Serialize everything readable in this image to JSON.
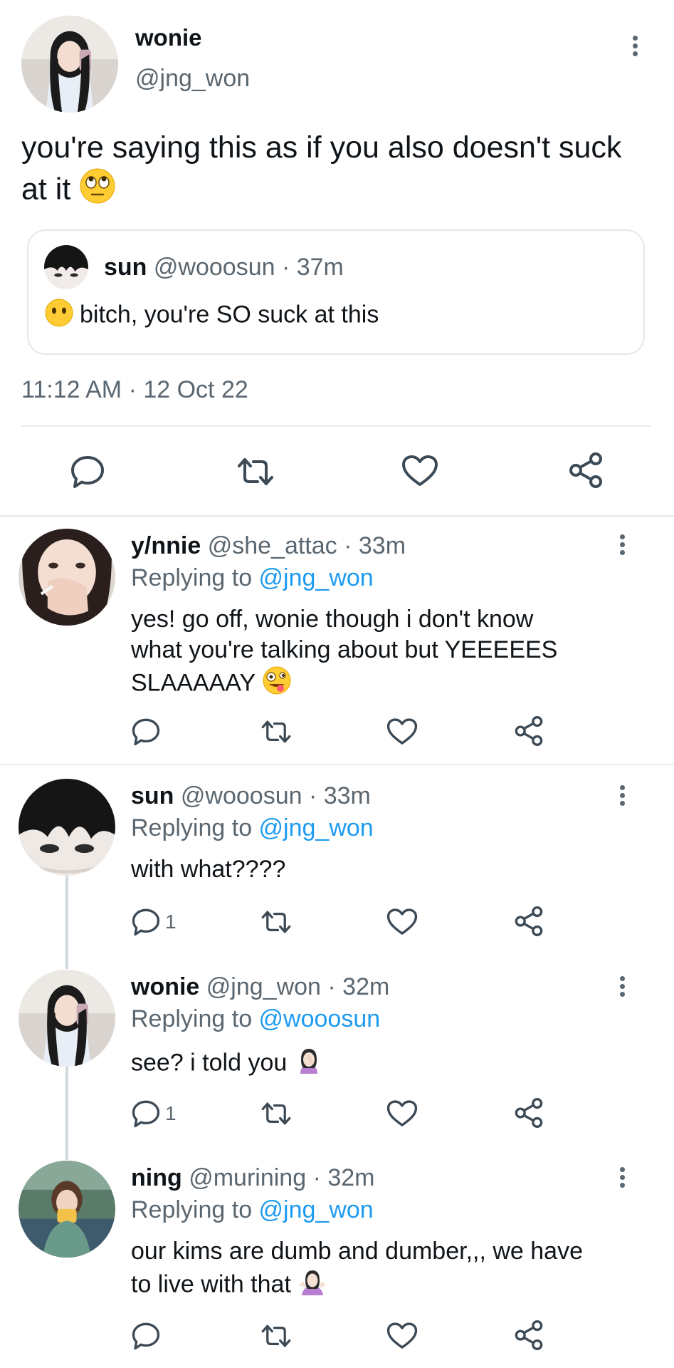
{
  "main_tweet": {
    "display_name": "wonie",
    "handle": "@jng_won",
    "text": "you're saying this as if you also doesn't suck at it",
    "emoji": "face-with-rolling-eyes",
    "timestamp": "11:12 AM · 12 Oct 22",
    "quote": {
      "display_name": "sun",
      "meta": "@wooosun · 37m",
      "emoji": "face-without-mouth",
      "text": "bitch, you're SO suck at this"
    }
  },
  "replies": [
    {
      "display_name": "y/nnie",
      "meta": "@she_attac · 33m",
      "replying_prefix": "Replying to ",
      "replying_to": "@jng_won",
      "text_lines": [
        "yes! go off, wonie though i don't know",
        "what you're talking about but YEEEEES",
        "SLAAAAAY"
      ],
      "emoji": "zany-face",
      "reply_count": ""
    },
    {
      "display_name": "sun",
      "meta": "@wooosun · 33m",
      "replying_prefix": "Replying to ",
      "replying_to": "@jng_won",
      "text_lines": [
        "with what????"
      ],
      "reply_count": "1"
    },
    {
      "display_name": "wonie",
      "meta": "@jng_won · 32m",
      "replying_prefix": "Replying to ",
      "replying_to": "@wooosun",
      "text_lines": [
        "see? i told you"
      ],
      "emoji": "person-facepalming",
      "reply_count": "1"
    },
    {
      "display_name": "ning",
      "meta": "@murining · 32m",
      "replying_prefix": "Replying to ",
      "replying_to": "@jng_won",
      "text_lines": [
        "our kims are dumb and dumber,,, we have",
        "to live with that"
      ],
      "emoji": "person-shrugging",
      "reply_count": ""
    }
  ],
  "icons": {
    "reply": "reply-icon",
    "retweet": "retweet-icon",
    "like": "heart-icon",
    "share": "share-icon",
    "more": "more-vertical-icon"
  },
  "colors": {
    "link_blue": "#1d9bf0",
    "meta_gray": "#5b6770",
    "divider": "#e7ecf0",
    "thread_line": "#cfd9de"
  }
}
